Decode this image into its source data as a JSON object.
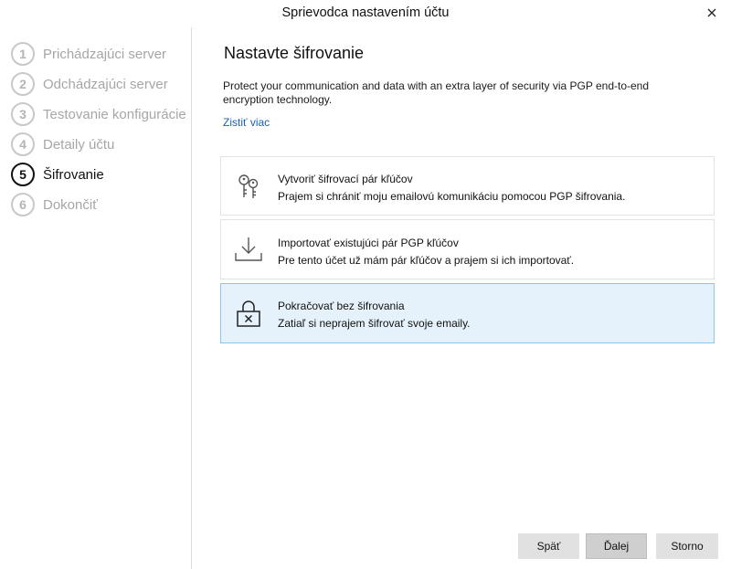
{
  "window": {
    "title": "Sprievodca nastavením účtu"
  },
  "sidebar": {
    "steps": [
      {
        "num": "1",
        "label": "Prichádzajúci server"
      },
      {
        "num": "2",
        "label": "Odchádzajúci server"
      },
      {
        "num": "3",
        "label": "Testovanie konfigurácie"
      },
      {
        "num": "4",
        "label": "Detaily účtu"
      },
      {
        "num": "5",
        "label": "Šifrovanie"
      },
      {
        "num": "6",
        "label": "Dokončiť"
      }
    ],
    "active_step": "5"
  },
  "main": {
    "heading": "Nastavte šifrovanie",
    "description": "Protect your communication and data with an extra layer of security via PGP end-to-end encryption technology.",
    "link": "Zistiť viac",
    "options": [
      {
        "icon": "keys-icon",
        "title": "Vytvoriť šifrovací pár kľúčov",
        "subtitle": "Prajem si chrániť moju emailovú komunikáciu pomocou PGP šifrovania.",
        "selected": false
      },
      {
        "icon": "download-icon",
        "title": "Importovať existujúci pár PGP kľúčov",
        "subtitle": "Pre tento účet už mám pár kľúčov a prajem si ich importovať.",
        "selected": false
      },
      {
        "icon": "unlocked-lock-icon",
        "title": "Pokračovať bez šifrovania",
        "subtitle": "Zatiaľ si neprajem šifrovať svoje emaily.",
        "selected": true
      }
    ]
  },
  "footer": {
    "back": "Späť",
    "next": "Ďalej",
    "cancel": "Storno"
  },
  "colors": {
    "selected_bg": "#e6f2fb",
    "selected_border": "#8cc4ee",
    "link": "#1a5fb4"
  }
}
